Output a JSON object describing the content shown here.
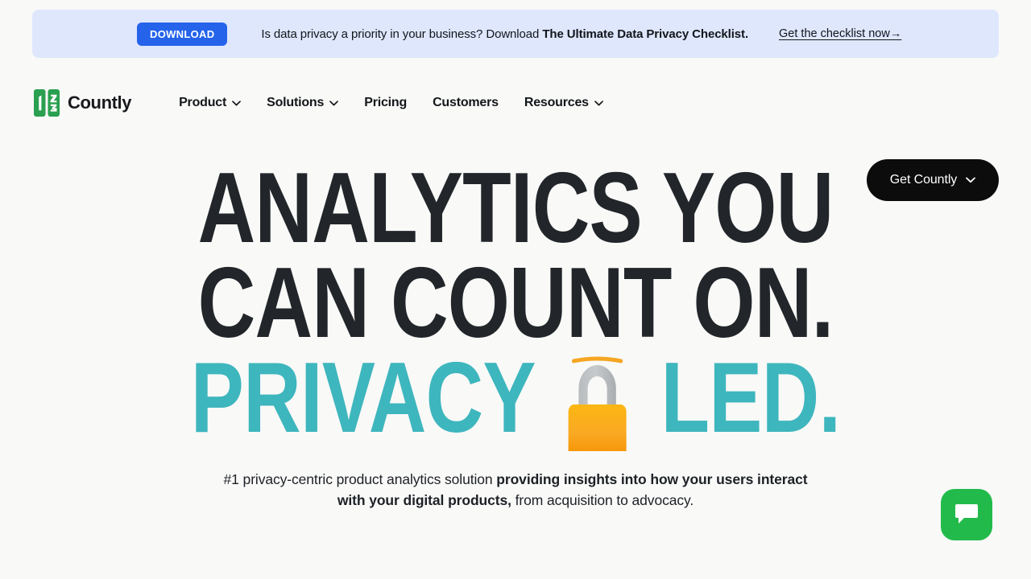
{
  "promo": {
    "badge_label": "DOWNLOAD",
    "message_prefix": "Is data privacy a priority in your business? Download ",
    "message_bold": "The Ultimate Data Privacy Checklist.",
    "link_label": "Get the checklist now→",
    "background_color": "#dfe7fd",
    "badge_color": "#2563eb"
  },
  "header": {
    "brand_name": "Countly",
    "brand_color": "#2aa050",
    "nav_items": [
      {
        "label": "Product",
        "has_dropdown": true
      },
      {
        "label": "Solutions",
        "has_dropdown": true
      },
      {
        "label": "Pricing",
        "has_dropdown": false
      },
      {
        "label": "Customers",
        "has_dropdown": false
      },
      {
        "label": "Resources",
        "has_dropdown": true
      }
    ],
    "cta_label": "Get Countly",
    "cta_background": "#0c0c0c"
  },
  "hero": {
    "headline_line1": "ANALYTICS YOU",
    "headline_line2": "CAN COUNT ON.",
    "headline_line3_prefix": "PRIVACY",
    "headline_line3_suffix": "LED.",
    "headline_accent_color": "#3eb6bd",
    "headline_color": "#22262a",
    "emoji": "lock-emoji",
    "sub_part1": "#1 privacy-centric product analytics solution ",
    "sub_bold1": "providing insights into how your users interact with your digital products,",
    "sub_part2": " from acquisition to advocacy."
  },
  "chat": {
    "icon": "chat-bubble-icon",
    "color": "#22bb4b"
  },
  "page": {
    "background_color": "#f9f9f8"
  }
}
